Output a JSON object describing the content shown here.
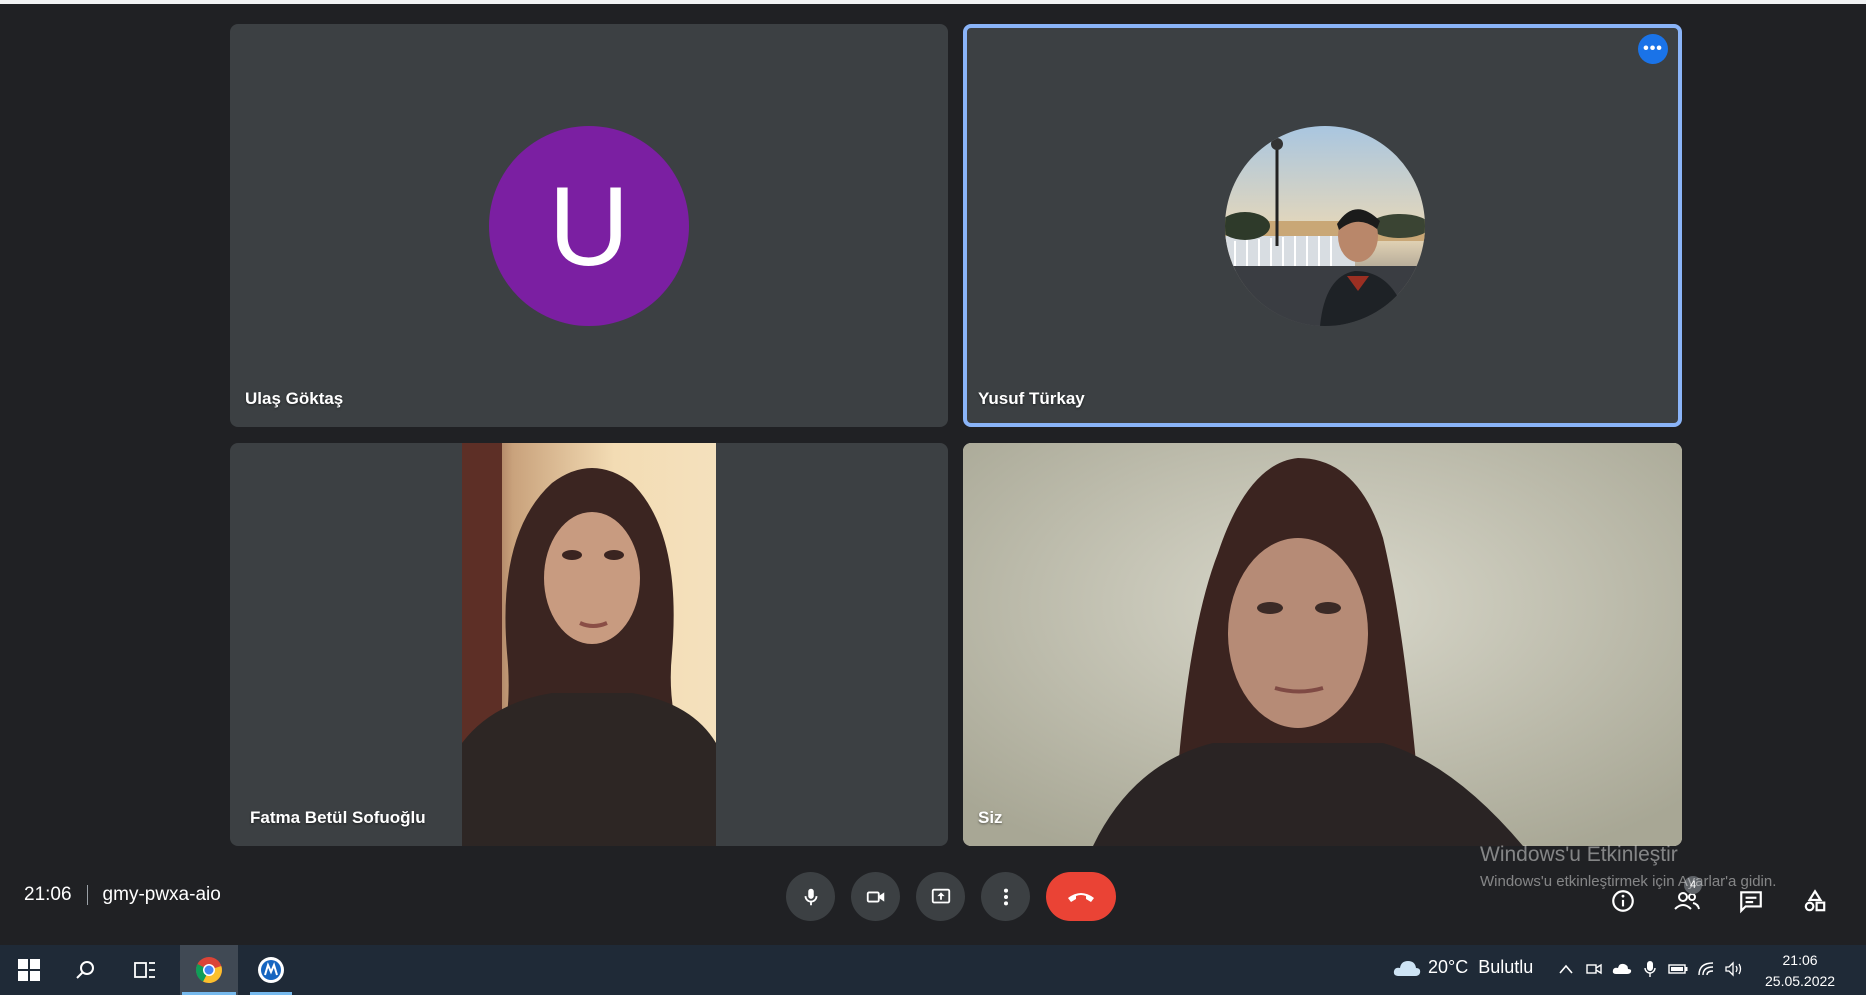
{
  "participants": [
    {
      "name": "Ulaş Göktaş",
      "avatar_letter": "U",
      "avatar_color": "#7b1fa2"
    },
    {
      "name": "Yusuf Türkay",
      "more_label": "•••",
      "highlight_color": "#8ab4f8"
    },
    {
      "name": "Fatma Betül Sofuoğlu"
    },
    {
      "name": "Siz"
    }
  ],
  "meeting": {
    "time": "21:06",
    "code": "gmy-pwxa-aio"
  },
  "controls": {
    "end_color": "#ea4335"
  },
  "people_badge": "4",
  "watermark": {
    "title": "Windows'u Etkinleştir",
    "subtitle": "Windows'u etkinleştirmek için Ayarlar'a gidin."
  },
  "taskbar": {
    "weather_temp": "20°C",
    "weather_desc": "Bulutlu",
    "clock_time": "21:06",
    "clock_date": "25.05.2022"
  }
}
